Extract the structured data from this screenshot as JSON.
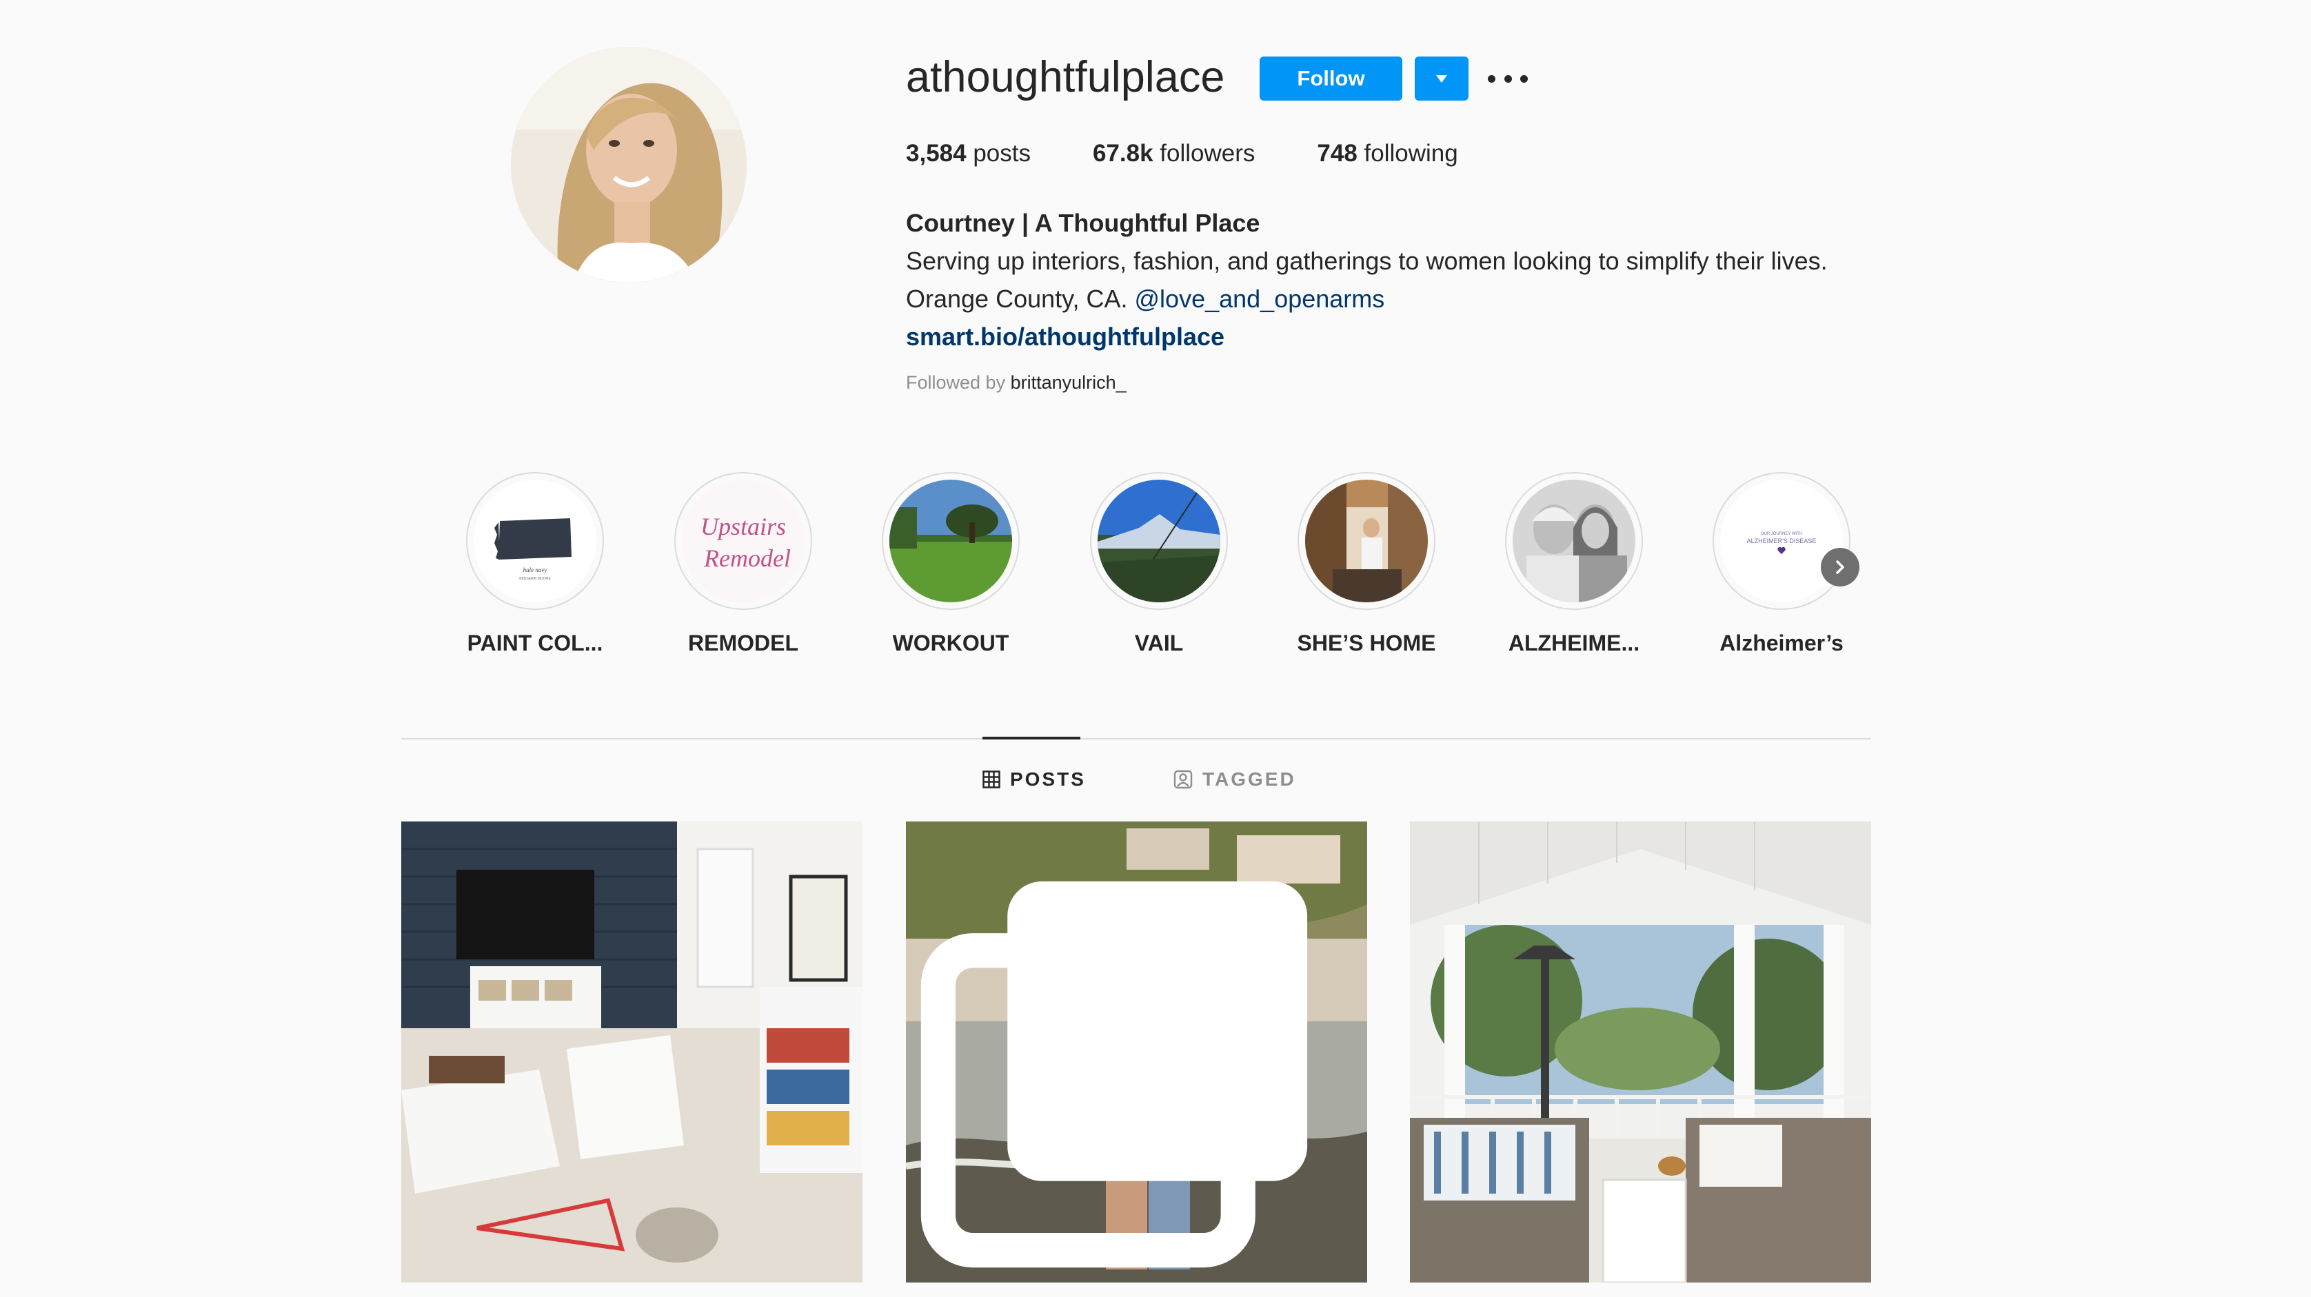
{
  "profile": {
    "username": "athoughtfulplace",
    "follow_label": "Follow",
    "stats": {
      "posts_count": "3,584",
      "posts_label": " posts",
      "followers_count": "67.8k",
      "followers_label": " followers",
      "following_count": "748",
      "following_label": " following"
    },
    "full_name": "Courtney | A Thoughtful Place",
    "bio_line1": "Serving up interiors, fashion, and gatherings to women looking to simplify their lives.",
    "bio_line2_prefix": "Orange County, CA. ",
    "bio_mention": "@love_and_openarms",
    "website": "smart.bio/athoughtfulplace",
    "followed_by_prefix": "Followed by ",
    "followed_by_user": "brittanyulrich_"
  },
  "highlights": [
    {
      "label": "PAINT COL...",
      "icon": "paint-swatch"
    },
    {
      "label": "REMODEL",
      "icon": "script-text"
    },
    {
      "label": "WORKOUT",
      "icon": "field-tree"
    },
    {
      "label": "VAIL",
      "icon": "mountain-sky"
    },
    {
      "label": "SHE’S HOME",
      "icon": "indoor-people"
    },
    {
      "label": "ALZHEIME...",
      "icon": "two-women"
    },
    {
      "label": "Alzheimer’s",
      "icon": "purple-heart-text"
    }
  ],
  "highlight_art_text": {
    "paint_caption": "hale navy",
    "paint_subcaption": "BENJAMIN MOORE",
    "remodel_line1": "Upstairs",
    "remodel_line2": "Remodel",
    "alz_line1": "OUR JOURNEY WITH",
    "alz_line2": "ALZHEIMER'S DISEASE"
  },
  "tabs": [
    {
      "label": "POSTS",
      "icon": "grid-icon",
      "active": true
    },
    {
      "label": "TAGGED",
      "icon": "tagged-user-icon",
      "active": false
    }
  ],
  "posts": [
    {
      "subject": "living room with shiplap wall, TV and white sofas",
      "multi": false
    },
    {
      "subject": "couple standing on rocky beach",
      "multi": true
    },
    {
      "subject": "covered patio with wicker furniture",
      "multi": false
    }
  ],
  "colors": {
    "primary_blue": "#0095f6",
    "link_blue": "#00376b",
    "text_dark": "#262626",
    "text_gray": "#8e8e8e",
    "divider": "#dbdbdb",
    "background": "#fafafa"
  }
}
